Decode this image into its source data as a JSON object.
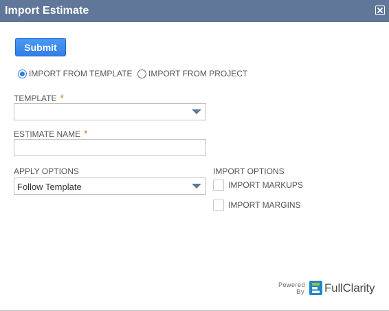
{
  "dialog": {
    "title": "Import Estimate",
    "close_icon": "close-icon",
    "submit_label": "Submit"
  },
  "import_source": {
    "options": [
      {
        "label": "IMPORT FROM TEMPLATE",
        "selected": true
      },
      {
        "label": "IMPORT FROM PROJECT",
        "selected": false
      }
    ]
  },
  "template": {
    "label": "TEMPLATE",
    "required_marker": "*",
    "value": ""
  },
  "estimate_name": {
    "label": "ESTIMATE NAME",
    "required_marker": "*",
    "value": ""
  },
  "apply_options": {
    "label": "APPLY OPTIONS",
    "value": "Follow Template"
  },
  "import_options": {
    "label": "IMPORT OPTIONS",
    "items": [
      {
        "label": "IMPORT MARKUPS",
        "checked": false
      },
      {
        "label": "IMPORT MARGINS",
        "checked": false
      }
    ]
  },
  "footer": {
    "powered_line1": "Powered",
    "powered_line2": "By",
    "brand": "FullClarity",
    "brand_icon": "fullclarity-logo-icon"
  },
  "colors": {
    "titlebar": "#607799",
    "accent": "#2f7fe6",
    "required": "#d1741f"
  }
}
